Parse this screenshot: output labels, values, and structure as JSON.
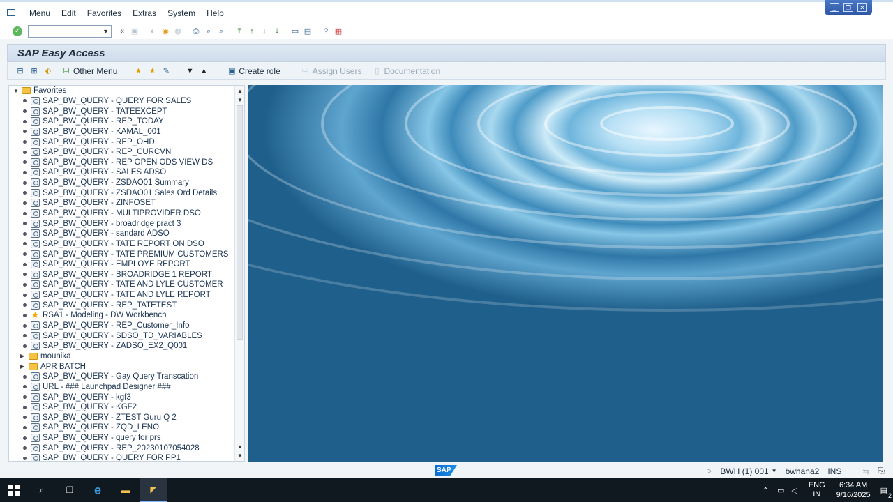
{
  "menubar": {
    "items": [
      {
        "label": "Menu"
      },
      {
        "label": "Edit"
      },
      {
        "label": "Favorites"
      },
      {
        "label": "Extras"
      },
      {
        "label": "System"
      },
      {
        "label": "Help"
      }
    ]
  },
  "toolbar": {
    "command_value": "",
    "back_glyph": "«"
  },
  "page": {
    "title": "SAP Easy Access"
  },
  "apptoolbar": {
    "other_menu": "Other Menu",
    "create_role": "Create role",
    "assign_users": "Assign Users",
    "documentation": "Documentation"
  },
  "tree": {
    "root": "Favorites",
    "items": [
      {
        "type": "tx",
        "label": "SAP_BW_QUERY - QUERY FOR SALES"
      },
      {
        "type": "tx",
        "label": "SAP_BW_QUERY - TATEEXCEPT"
      },
      {
        "type": "tx",
        "label": "SAP_BW_QUERY - REP_TODAY"
      },
      {
        "type": "tx",
        "label": "SAP_BW_QUERY - KAMAL_001"
      },
      {
        "type": "tx",
        "label": "SAP_BW_QUERY - REP_OHD"
      },
      {
        "type": "tx",
        "label": "SAP_BW_QUERY - REP_CURCVN"
      },
      {
        "type": "tx",
        "label": "SAP_BW_QUERY - REP OPEN ODS VIEW DS"
      },
      {
        "type": "tx",
        "label": "SAP_BW_QUERY - SALES ADSO"
      },
      {
        "type": "tx",
        "label": "SAP_BW_QUERY - ZSDAO01 Summary"
      },
      {
        "type": "tx",
        "label": "SAP_BW_QUERY - ZSDAO01 Sales Ord Details"
      },
      {
        "type": "tx",
        "label": "SAP_BW_QUERY - ZINFOSET"
      },
      {
        "type": "tx",
        "label": "SAP_BW_QUERY - MULTIPROVIDER DSO"
      },
      {
        "type": "tx",
        "label": "SAP_BW_QUERY - broadridge pract 3"
      },
      {
        "type": "tx",
        "label": "SAP_BW_QUERY - sandard ADSO"
      },
      {
        "type": "tx",
        "label": "SAP_BW_QUERY - TATE REPORT ON DSO"
      },
      {
        "type": "tx",
        "label": "SAP_BW_QUERY - TATE PREMIUM CUSTOMERS"
      },
      {
        "type": "tx",
        "label": "SAP_BW_QUERY - EMPLOYE REPORT"
      },
      {
        "type": "tx",
        "label": "SAP_BW_QUERY - BROADRIDGE 1 REPORT"
      },
      {
        "type": "tx",
        "label": "SAP_BW_QUERY - TATE AND LYLE CUSTOMER"
      },
      {
        "type": "tx",
        "label": "SAP_BW_QUERY - TATE AND LYLE REPORT"
      },
      {
        "type": "tx",
        "label": "SAP_BW_QUERY - REP_TATETEST"
      },
      {
        "type": "star",
        "label": "RSA1 - Modeling - DW Workbench"
      },
      {
        "type": "tx",
        "label": "SAP_BW_QUERY - REP_Customer_Info"
      },
      {
        "type": "tx",
        "label": "SAP_BW_QUERY - SDSO_TD_VARIABLES"
      },
      {
        "type": "tx",
        "label": "SAP_BW_QUERY - ZADSO_EX2_Q001"
      },
      {
        "type": "folder",
        "label": "mounika"
      },
      {
        "type": "folder",
        "label": "APR BATCH"
      },
      {
        "type": "tx",
        "label": "SAP_BW_QUERY - Gay Query Transcation"
      },
      {
        "type": "tx",
        "label": "URL - ### Launchpad Designer ###"
      },
      {
        "type": "tx",
        "label": "SAP_BW_QUERY - kgf3"
      },
      {
        "type": "tx",
        "label": "SAP_BW_QUERY - KGF2"
      },
      {
        "type": "tx",
        "label": "SAP_BW_QUERY - ZTEST Guru Q 2"
      },
      {
        "type": "tx",
        "label": "SAP_BW_QUERY - ZQD_LENO"
      },
      {
        "type": "tx",
        "label": "SAP_BW_QUERY - query for prs"
      },
      {
        "type": "tx",
        "label": "SAP_BW_QUERY - REP_20230107054028"
      },
      {
        "type": "tx",
        "label": "SAP_BW_QUERY - QUERY FOR PP1"
      }
    ]
  },
  "statusbar": {
    "logo": "SAP",
    "system": "BWH (1) 001",
    "server": "bwhana2",
    "mode": "INS"
  },
  "taskbar": {
    "lang_top": "ENG",
    "lang_bottom": "IN",
    "time": "6:34 AM",
    "date": "9/16/2025",
    "notif_count": "2"
  }
}
